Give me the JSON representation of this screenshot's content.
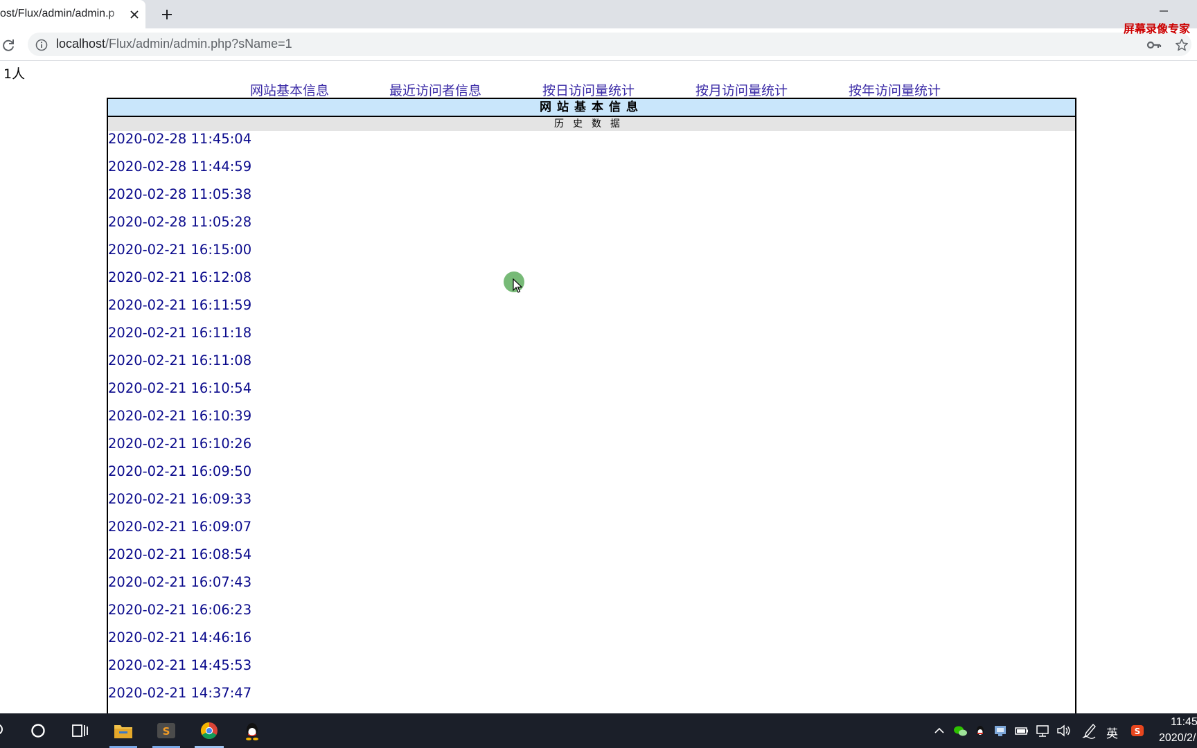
{
  "browser": {
    "tab_title": "ost/Flux/admin/admin.p",
    "url_host": "localhost",
    "url_path": "/Flux/admin/admin.php?sName=1"
  },
  "watermark": "屏幕录像专家",
  "page": {
    "online_count": "1人",
    "nav": [
      {
        "label": "网站基本信息"
      },
      {
        "label": "最近访问者信息"
      },
      {
        "label": "按日访问量统计"
      },
      {
        "label": "按月访问量统计"
      },
      {
        "label": "按年访问量统计"
      }
    ],
    "box_title": "网站基本信息",
    "box_subtitle": "历史数据",
    "history": [
      "2020-02-28 11:45:04",
      "2020-02-28 11:44:59",
      "2020-02-28 11:05:38",
      "2020-02-28 11:05:28",
      "2020-02-21 16:15:00",
      "2020-02-21 16:12:08",
      "2020-02-21 16:11:59",
      "2020-02-21 16:11:18",
      "2020-02-21 16:11:08",
      "2020-02-21 16:10:54",
      "2020-02-21 16:10:39",
      "2020-02-21 16:10:26",
      "2020-02-21 16:09:50",
      "2020-02-21 16:09:33",
      "2020-02-21 16:09:07",
      "2020-02-21 16:08:54",
      "2020-02-21 16:07:43",
      "2020-02-21 16:06:23",
      "2020-02-21 14:46:16",
      "2020-02-21 14:45:53",
      "2020-02-21 14:37:47"
    ]
  },
  "taskbar": {
    "ime_label": "英",
    "clock_time": "11:45",
    "clock_date": "2020/2/"
  },
  "colors": {
    "link": "#3a2aa6",
    "history_text": "#0a0a8c",
    "title_bg": "#c9e6fb",
    "subtitle_bg": "#e4e4e4",
    "watermark": "#cc0000"
  }
}
